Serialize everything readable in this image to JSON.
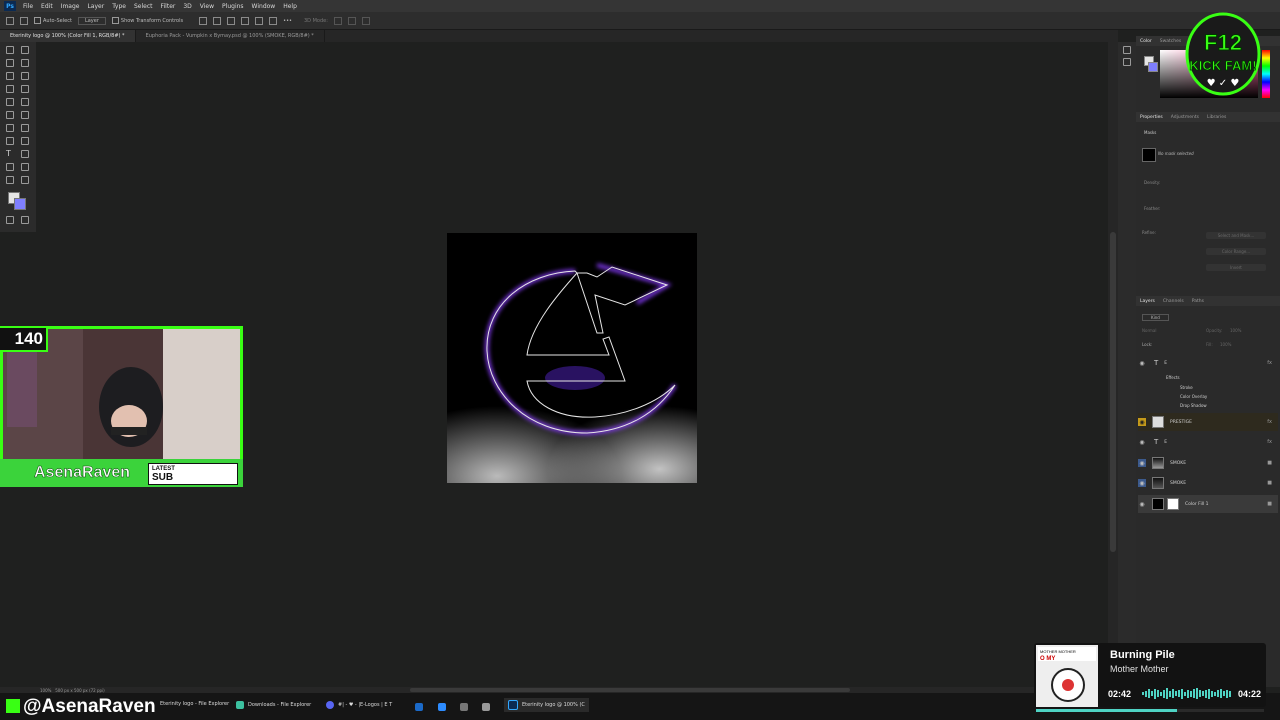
{
  "menu": [
    "File",
    "Edit",
    "Image",
    "Layer",
    "Type",
    "Select",
    "Filter",
    "3D",
    "View",
    "Plugins",
    "Window",
    "Help"
  ],
  "options_bar": {
    "auto_select_label": "Auto-Select",
    "layer_dropdown": "Layer",
    "transform_label": "Show Transform Controls",
    "mode_3d_label": "3D Mode:"
  },
  "doc_tabs": [
    {
      "label": "Eterinity logo @ 100% (Color Fill 1, RGB/8#) *"
    },
    {
      "label": "Euphoria Pack - Vumpkin x Bymay.psd @ 100% (SMOKE, RGB/8#) *"
    }
  ],
  "status": {
    "zoom": "100%",
    "doc_size": "500 px x 500 px (72 ppi)"
  },
  "color_panel": {
    "tabs": [
      "Color",
      "Swatches"
    ],
    "fg": "#e5e5e5",
    "bg": "#7f7fff"
  },
  "properties_panel": {
    "tabs": [
      "Properties",
      "Adjustments",
      "Libraries"
    ],
    "section": "Masks",
    "no_mask": "No mask selected",
    "density_label": "Density:",
    "feather_label": "Feather:",
    "refine_label": "Refine:",
    "buttons": [
      "Select and Mask...",
      "Color Range...",
      "Invert"
    ]
  },
  "layers_panel": {
    "tabs": [
      "Layers",
      "Channels",
      "Paths"
    ],
    "filter": "Kind",
    "blend": "Normal",
    "opacity_label": "Opacity:",
    "opacity_value": "100%",
    "lock_label": "Lock:",
    "fill_label": "Fill:",
    "fill_value": "100%",
    "layers": [
      {
        "name": "E",
        "type": "text"
      },
      {
        "name": "PRESTIGE",
        "type": "image"
      },
      {
        "name": "E",
        "type": "text"
      },
      {
        "name": "SMOKE",
        "type": "image"
      },
      {
        "name": "SMOKE",
        "type": "image"
      },
      {
        "name": "Color Fill 1",
        "type": "fill"
      }
    ],
    "effects_label": "Effects",
    "effects": [
      "Stroke",
      "Color Overlay",
      "Drop Shadow"
    ]
  },
  "webcam": {
    "count": "140",
    "name": "AsenaRaven",
    "tag_line1": "LATEST",
    "tag_line2": "SUB",
    "accent": "#39ff14"
  },
  "overlay": {
    "handle": "@AsenaRaven",
    "badge_text": "F12 KICK FAM!"
  },
  "music": {
    "title": "Burning Pile",
    "artist": "Mother Mother",
    "current": "02:42",
    "total": "04:22",
    "progress": 0.62,
    "album_text_1": "MOTHER MOTHER",
    "album_text_2": "O MY"
  },
  "taskbar": [
    {
      "label": "Eterinity logo - File Explorer"
    },
    {
      "label": "Downloads - File Explorer"
    },
    {
      "label": "#| - ♥ - |E-Logos | E T"
    },
    {
      "label": "Eterinity logo @ 100% (C"
    }
  ]
}
